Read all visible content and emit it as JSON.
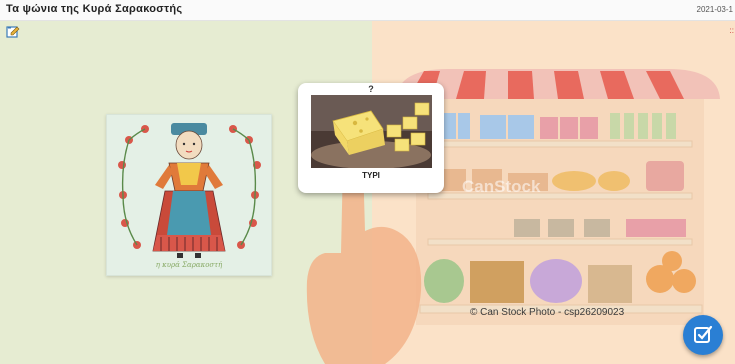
{
  "header": {
    "title": "Τα ψώνια της Κυρά Σαρακοστής",
    "date": "2021-03-1"
  },
  "toolbar": {
    "help_icon": "edit-help-icon",
    "corner_mark": "::"
  },
  "doll": {
    "caption": "η κυρά Σαρακοστή"
  },
  "card": {
    "question_mark": "?",
    "label": "ΤΥΡΙ",
    "image": "cheese"
  },
  "store": {
    "watermark": "© Can Stock Photo - csp26209023",
    "center_watermark": "CanStock"
  },
  "check_button": {
    "icon": "check-edit-icon",
    "color": "#2a7fd4"
  },
  "colors": {
    "left_background": "#e6ecd2",
    "right_background": "#fbe2c8"
  }
}
